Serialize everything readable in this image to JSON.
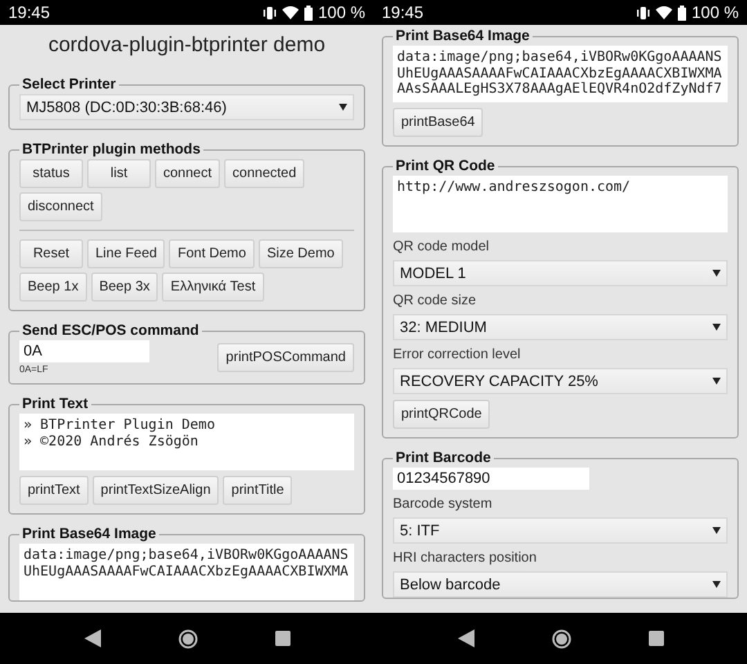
{
  "screens": [
    {
      "status_bar": {
        "time": "19:45",
        "battery": "100 %"
      },
      "title": "cordova-plugin-btprinter demo",
      "sections": [
        {
          "legend": "Select Printer",
          "items": [
            {
              "kind": "select",
              "value": "MJ5808 (DC:0D:30:3B:68:46)"
            }
          ]
        },
        {
          "legend": "BTPrinter plugin methods",
          "items": [
            {
              "kind": "buttons",
              "labels": [
                "status",
                "list",
                "connect",
                "connected",
                "disconnect"
              ]
            },
            {
              "kind": "divider"
            },
            {
              "kind": "buttons",
              "labels": [
                "Reset",
                "Line Feed",
                "Font Demo",
                "Size Demo",
                "Beep 1x",
                "Beep 3x",
                "Ελληνικά Test"
              ]
            }
          ]
        },
        {
          "legend": "Send ESC/POS command",
          "items": [
            {
              "kind": "command",
              "value": "0A",
              "hint": "0A=LF",
              "button": "printPOSCommand"
            }
          ]
        },
        {
          "legend": "Print Text",
          "items": [
            {
              "kind": "textarea",
              "lines": [
                "» BTPrinter Plugin Demo",
                "» ©2020 Andrés Zsögön"
              ]
            },
            {
              "kind": "buttons",
              "labels": [
                "printText",
                "printTextSizeAlign",
                "printTitle"
              ]
            }
          ]
        },
        {
          "legend": "Print Base64 Image",
          "items": [
            {
              "kind": "textarea",
              "lines": [
                "data:image/png;base64,iVBORw0KGgoAAAANS",
                "UhEUgAAASAAAAFwCAIAAACXbzEgAAAACXBIWXMA"
              ]
            }
          ]
        }
      ]
    },
    {
      "status_bar": {
        "time": "19:45",
        "battery": "100 %"
      },
      "sections": [
        {
          "legend": "Print Base64 Image",
          "items": [
            {
              "kind": "textarea",
              "lines": [
                "data:image/png;base64,iVBORw0KGgoAAAANS",
                "UhEUgAAASAAAAFwCAIAAACXbzEgAAAACXBIWXMA",
                "AAsSAAALEgHS3X78AAAgAElEQVR4nO2dfZyNdf7"
              ]
            },
            {
              "kind": "buttons",
              "labels": [
                "printBase64"
              ]
            }
          ]
        },
        {
          "legend": "Print QR Code",
          "items": [
            {
              "kind": "textarea",
              "lines": [
                "http://www.andreszsogon.com/"
              ]
            },
            {
              "kind": "label",
              "text": "QR code model"
            },
            {
              "kind": "select",
              "value": "MODEL 1"
            },
            {
              "kind": "label",
              "text": "QR code size"
            },
            {
              "kind": "select",
              "value": "32: MEDIUM"
            },
            {
              "kind": "label",
              "text": "Error correction level"
            },
            {
              "kind": "select",
              "value": "RECOVERY CAPACITY 25%"
            },
            {
              "kind": "buttons",
              "labels": [
                "printQRCode"
              ]
            }
          ]
        },
        {
          "legend": "Print Barcode",
          "items": [
            {
              "kind": "field",
              "value": "01234567890"
            },
            {
              "kind": "label",
              "text": "Barcode system"
            },
            {
              "kind": "select",
              "value": "5: ITF"
            },
            {
              "kind": "label",
              "text": "HRI characters position"
            },
            {
              "kind": "select",
              "value": "Below barcode"
            }
          ]
        }
      ]
    }
  ]
}
